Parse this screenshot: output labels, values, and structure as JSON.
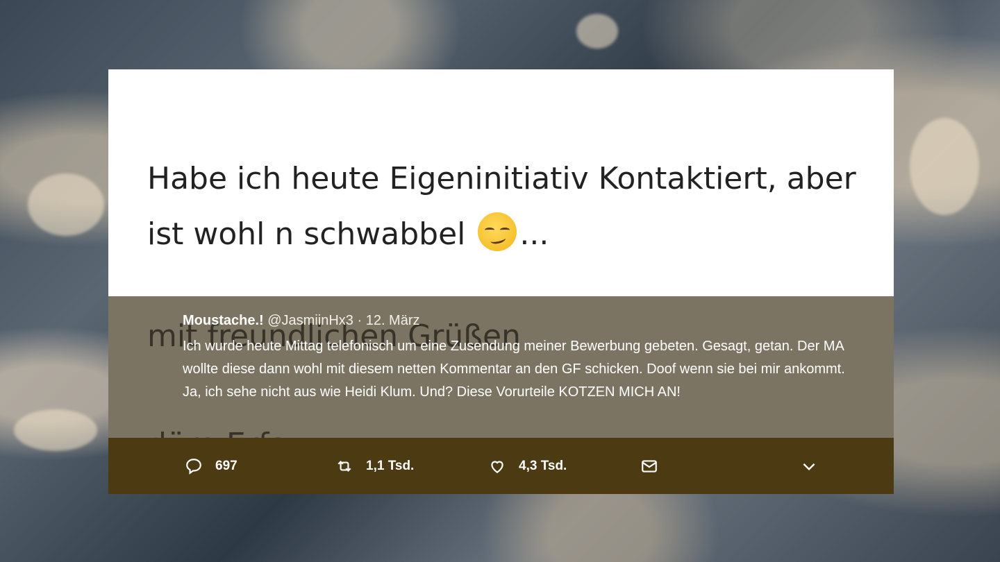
{
  "tweet": {
    "headline_line1": "Habe ich heute Eigeninitiativ Kontaktiert, aber",
    "headline_line2_before_emoji": "ist wohl n schwabbel",
    "headline_line2_after_emoji": "...",
    "emoji_icon": "smirking-face-emoji",
    "ghost_line1": "mit freundlichen Grüßen",
    "ghost_line2": "düre Erfa"
  },
  "quoted_tweet": {
    "name": "Moustache.!",
    "handle": "@JasmiinHx3",
    "date": "· 12. März",
    "text": "Ich wurde heute Mittag telefonisch um eine Zusendung meiner Bewerbung gebeten. Gesagt, getan. Der MA wollte diese dann wohl mit diesem netten Kommentar an den GF schicken. Doof wenn sie bei mir ankommt. Ja, ich sehe nicht aus wie Heidi Klum. Und? Diese Vorurteile KOTZEN MICH AN!"
  },
  "actions": {
    "reply_count": "697",
    "retweet_count": "1,1 Tsd.",
    "like_count": "4,3 Tsd.",
    "icons": [
      "reply-icon",
      "retweet-icon",
      "like-icon",
      "mail-icon",
      "chevron-down-icon"
    ]
  },
  "colors": {
    "quote_bg": "#7c7462",
    "action_bar_bg": "#4b3a12",
    "card_bg": "#ffffff"
  }
}
